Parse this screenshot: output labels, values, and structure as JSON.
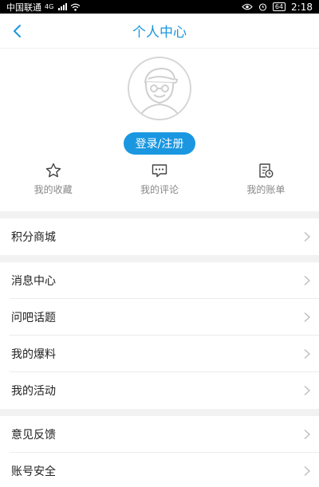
{
  "status_bar": {
    "carrier": "中国联通",
    "network": "4G",
    "battery": "64",
    "time": "2:18"
  },
  "header": {
    "title": "个人中心"
  },
  "profile": {
    "login_label": "登录/注册"
  },
  "quick_actions": [
    {
      "label": "我的收藏",
      "icon": "star-icon"
    },
    {
      "label": "我的评论",
      "icon": "comment-icon"
    },
    {
      "label": "我的账单",
      "icon": "bill-icon"
    }
  ],
  "menu": {
    "group1": [
      {
        "label": "积分商城"
      }
    ],
    "group2": [
      {
        "label": "消息中心"
      },
      {
        "label": "问吧话题"
      },
      {
        "label": "我的爆料"
      },
      {
        "label": "我的活动"
      }
    ],
    "group3": [
      {
        "label": "意见反馈"
      },
      {
        "label": "账号安全"
      }
    ]
  },
  "colors": {
    "accent": "#1a97e0",
    "divider": "#ececec",
    "section_gap": "#f2f2f2"
  }
}
